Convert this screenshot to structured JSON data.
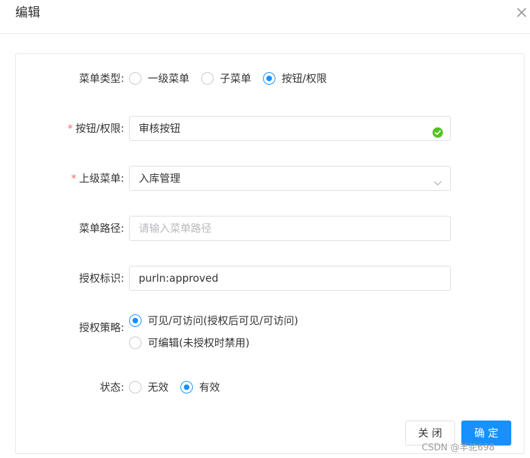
{
  "dialog": {
    "title": "编辑",
    "close_icon": "close-icon"
  },
  "form": {
    "menu_type": {
      "label": "菜单类型:",
      "options": [
        "一级菜单",
        "子菜单",
        "按钮/权限"
      ],
      "selected": "按钮/权限"
    },
    "button_permission": {
      "label": "按钮/权限:",
      "required": true,
      "value": "审核按钮",
      "status_icon": "check-circle-icon"
    },
    "parent_menu": {
      "label": "上级菜单:",
      "required": true,
      "value": "入库管理",
      "dropdown_icon": "chevron-down-icon"
    },
    "menu_path": {
      "label": "菜单路径:",
      "value": "",
      "placeholder": "请输入菜单路径"
    },
    "auth_identifier": {
      "label": "授权标识:",
      "value": "purln:approved"
    },
    "auth_policy": {
      "label": "授权策略:",
      "options": [
        "可见/可访问(授权后可见/可访问)",
        "可编辑(未授权时禁用)"
      ],
      "selected": "可见/可访问(授权后可见/可访问)"
    },
    "status": {
      "label": "状态:",
      "options": [
        "无效",
        "有效"
      ],
      "selected": "有效"
    }
  },
  "footer": {
    "close_label": "关 闭",
    "ok_label": "确 定"
  },
  "watermark": "CSDN @羊驼698",
  "colors": {
    "primary": "#1890ff",
    "required": "#f56c6c",
    "success": "#52c41a",
    "border": "#dcdfe6"
  }
}
